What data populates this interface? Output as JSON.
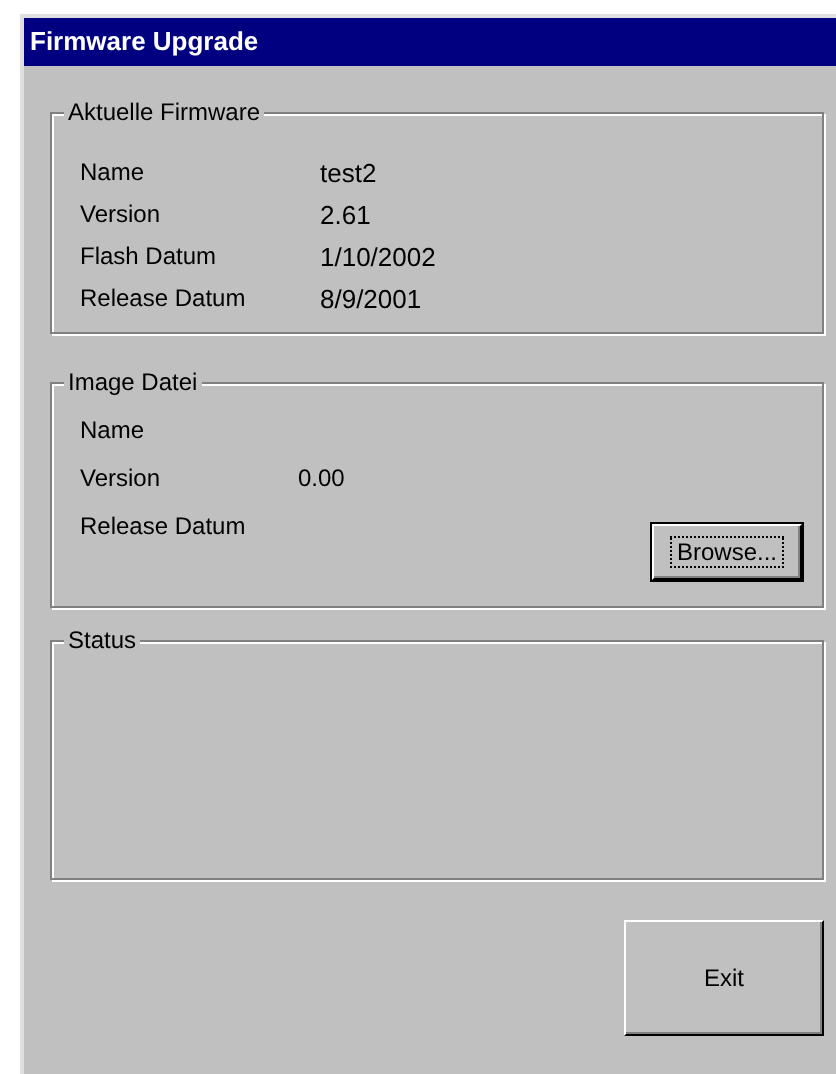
{
  "window": {
    "title": "Firmware Upgrade"
  },
  "groups": [
    {
      "title": "Aktuelle Firmware",
      "kind": "current",
      "fields": [
        {
          "label": "Name",
          "value": "test2"
        },
        {
          "label": "Version",
          "value": "2.61"
        },
        {
          "label": "Flash Datum",
          "value": "1/10/2002"
        },
        {
          "label": "Release Datum",
          "value": "8/9/2001"
        }
      ]
    },
    {
      "title": "Image Datei",
      "kind": "image",
      "fields": [
        {
          "label": "Name"
        },
        {
          "label": "Version",
          "value": "0.00"
        },
        {
          "label": "Release Datum"
        }
      ],
      "button": {
        "label": "Browse...",
        "focused": true
      }
    },
    {
      "title": "Status",
      "kind": "status"
    }
  ],
  "buttons": [
    {
      "label": "Exit",
      "focused": false
    }
  ]
}
